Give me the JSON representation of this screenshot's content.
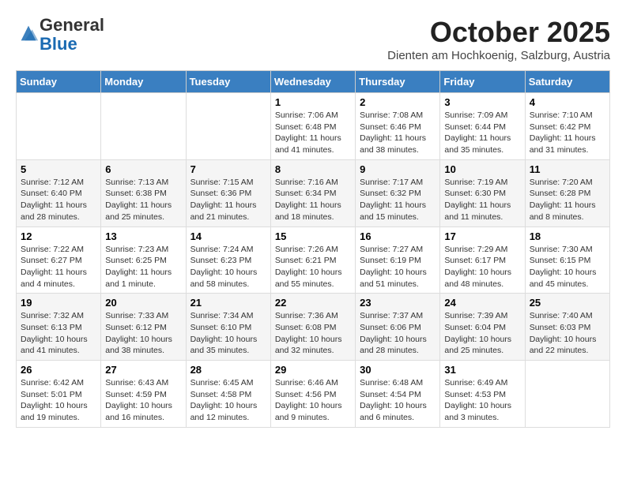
{
  "logo": {
    "general": "General",
    "blue": "Blue"
  },
  "header": {
    "month": "October 2025",
    "location": "Dienten am Hochkoenig, Salzburg, Austria"
  },
  "days_of_week": [
    "Sunday",
    "Monday",
    "Tuesday",
    "Wednesday",
    "Thursday",
    "Friday",
    "Saturday"
  ],
  "weeks": [
    [
      {
        "day": "",
        "info": ""
      },
      {
        "day": "",
        "info": ""
      },
      {
        "day": "",
        "info": ""
      },
      {
        "day": "1",
        "info": "Sunrise: 7:06 AM\nSunset: 6:48 PM\nDaylight: 11 hours and 41 minutes."
      },
      {
        "day": "2",
        "info": "Sunrise: 7:08 AM\nSunset: 6:46 PM\nDaylight: 11 hours and 38 minutes."
      },
      {
        "day": "3",
        "info": "Sunrise: 7:09 AM\nSunset: 6:44 PM\nDaylight: 11 hours and 35 minutes."
      },
      {
        "day": "4",
        "info": "Sunrise: 7:10 AM\nSunset: 6:42 PM\nDaylight: 11 hours and 31 minutes."
      }
    ],
    [
      {
        "day": "5",
        "info": "Sunrise: 7:12 AM\nSunset: 6:40 PM\nDaylight: 11 hours and 28 minutes."
      },
      {
        "day": "6",
        "info": "Sunrise: 7:13 AM\nSunset: 6:38 PM\nDaylight: 11 hours and 25 minutes."
      },
      {
        "day": "7",
        "info": "Sunrise: 7:15 AM\nSunset: 6:36 PM\nDaylight: 11 hours and 21 minutes."
      },
      {
        "day": "8",
        "info": "Sunrise: 7:16 AM\nSunset: 6:34 PM\nDaylight: 11 hours and 18 minutes."
      },
      {
        "day": "9",
        "info": "Sunrise: 7:17 AM\nSunset: 6:32 PM\nDaylight: 11 hours and 15 minutes."
      },
      {
        "day": "10",
        "info": "Sunrise: 7:19 AM\nSunset: 6:30 PM\nDaylight: 11 hours and 11 minutes."
      },
      {
        "day": "11",
        "info": "Sunrise: 7:20 AM\nSunset: 6:28 PM\nDaylight: 11 hours and 8 minutes."
      }
    ],
    [
      {
        "day": "12",
        "info": "Sunrise: 7:22 AM\nSunset: 6:27 PM\nDaylight: 11 hours and 4 minutes."
      },
      {
        "day": "13",
        "info": "Sunrise: 7:23 AM\nSunset: 6:25 PM\nDaylight: 11 hours and 1 minute."
      },
      {
        "day": "14",
        "info": "Sunrise: 7:24 AM\nSunset: 6:23 PM\nDaylight: 10 hours and 58 minutes."
      },
      {
        "day": "15",
        "info": "Sunrise: 7:26 AM\nSunset: 6:21 PM\nDaylight: 10 hours and 55 minutes."
      },
      {
        "day": "16",
        "info": "Sunrise: 7:27 AM\nSunset: 6:19 PM\nDaylight: 10 hours and 51 minutes."
      },
      {
        "day": "17",
        "info": "Sunrise: 7:29 AM\nSunset: 6:17 PM\nDaylight: 10 hours and 48 minutes."
      },
      {
        "day": "18",
        "info": "Sunrise: 7:30 AM\nSunset: 6:15 PM\nDaylight: 10 hours and 45 minutes."
      }
    ],
    [
      {
        "day": "19",
        "info": "Sunrise: 7:32 AM\nSunset: 6:13 PM\nDaylight: 10 hours and 41 minutes."
      },
      {
        "day": "20",
        "info": "Sunrise: 7:33 AM\nSunset: 6:12 PM\nDaylight: 10 hours and 38 minutes."
      },
      {
        "day": "21",
        "info": "Sunrise: 7:34 AM\nSunset: 6:10 PM\nDaylight: 10 hours and 35 minutes."
      },
      {
        "day": "22",
        "info": "Sunrise: 7:36 AM\nSunset: 6:08 PM\nDaylight: 10 hours and 32 minutes."
      },
      {
        "day": "23",
        "info": "Sunrise: 7:37 AM\nSunset: 6:06 PM\nDaylight: 10 hours and 28 minutes."
      },
      {
        "day": "24",
        "info": "Sunrise: 7:39 AM\nSunset: 6:04 PM\nDaylight: 10 hours and 25 minutes."
      },
      {
        "day": "25",
        "info": "Sunrise: 7:40 AM\nSunset: 6:03 PM\nDaylight: 10 hours and 22 minutes."
      }
    ],
    [
      {
        "day": "26",
        "info": "Sunrise: 6:42 AM\nSunset: 5:01 PM\nDaylight: 10 hours and 19 minutes."
      },
      {
        "day": "27",
        "info": "Sunrise: 6:43 AM\nSunset: 4:59 PM\nDaylight: 10 hours and 16 minutes."
      },
      {
        "day": "28",
        "info": "Sunrise: 6:45 AM\nSunset: 4:58 PM\nDaylight: 10 hours and 12 minutes."
      },
      {
        "day": "29",
        "info": "Sunrise: 6:46 AM\nSunset: 4:56 PM\nDaylight: 10 hours and 9 minutes."
      },
      {
        "day": "30",
        "info": "Sunrise: 6:48 AM\nSunset: 4:54 PM\nDaylight: 10 hours and 6 minutes."
      },
      {
        "day": "31",
        "info": "Sunrise: 6:49 AM\nSunset: 4:53 PM\nDaylight: 10 hours and 3 minutes."
      },
      {
        "day": "",
        "info": ""
      }
    ]
  ]
}
